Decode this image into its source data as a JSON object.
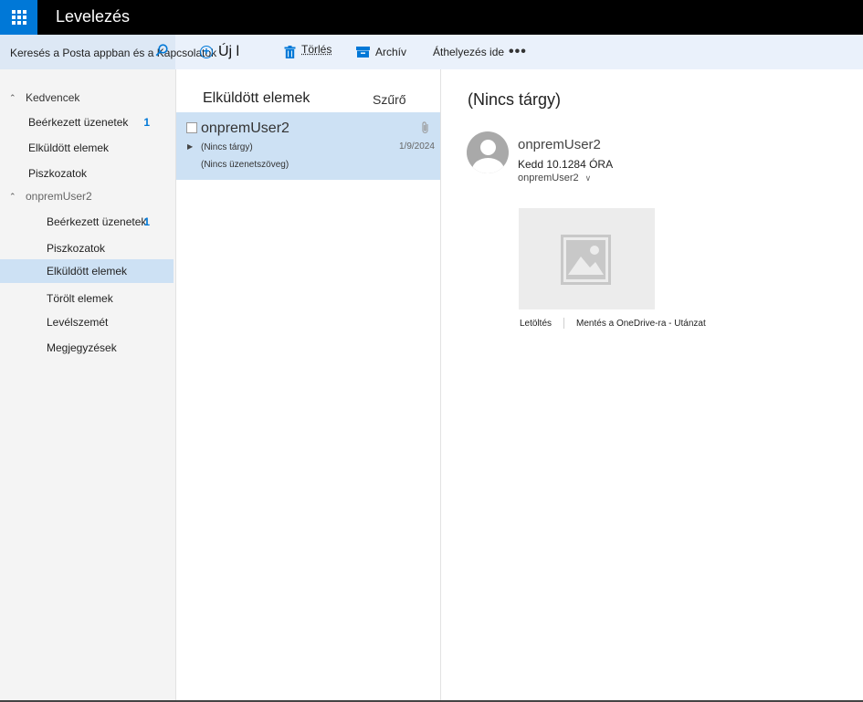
{
  "header": {
    "app_title": "Levelezés",
    "waffle_icon": "app-launcher-icon"
  },
  "command_bar": {
    "search_placeholder": "Keresés a Posta appban és a Kapcsolatok",
    "new_label": "Új l",
    "delete_label": "Törlés",
    "archive_label": "Archív",
    "move_label": "Áthelyezés ide",
    "more_label": "•••"
  },
  "folders": {
    "favorites_label": "Kedvencek",
    "favorites": [
      {
        "label": "Beérkezett üzenetek",
        "count": "1"
      },
      {
        "label": "Elküldött elemek",
        "count": ""
      },
      {
        "label": "Piszkozatok",
        "count": ""
      }
    ],
    "account_label": "onpremUser2",
    "account_folders": [
      {
        "label": "Beérkezett üzenetek",
        "count": "1"
      },
      {
        "label": "Piszkozatok",
        "count": ""
      },
      {
        "label": "Elküldött elemek",
        "count": "",
        "selected": true
      },
      {
        "label": "Törölt elemek",
        "count": ""
      },
      {
        "label": "Levélszemét",
        "count": ""
      },
      {
        "label": "Megjegyzések",
        "count": ""
      }
    ]
  },
  "message_list": {
    "title": "Elküldött elemek",
    "filter_label": "Szűrő",
    "messages": [
      {
        "sender": "onpremUser2",
        "subject": "(Nincs tárgy)",
        "date": "1/9/2024",
        "preview": "(Nincs üzenetszöveg)",
        "has_attachment": true
      }
    ]
  },
  "reading_pane": {
    "subject": "(Nincs tárgy)",
    "from": "onpremUser2",
    "sent": "Kedd 10.1284 ÓRA",
    "to": "onpremUser2",
    "attachment_actions": {
      "download": "Letöltés",
      "save": "Mentés a OneDrive-ra - Utánzat"
    }
  },
  "colors": {
    "accent": "#0078d7",
    "header_bg": "#000000",
    "selection": "#cde1f4"
  }
}
